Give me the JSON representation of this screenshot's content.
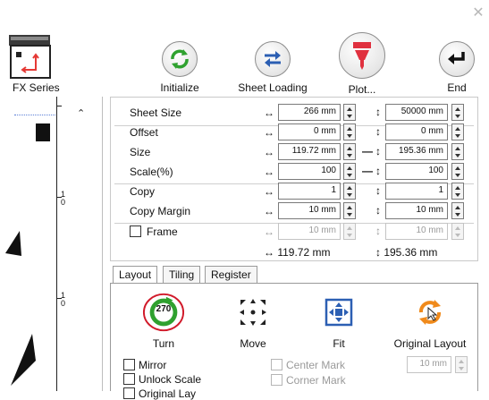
{
  "window": {
    "close_icon": "close-icon"
  },
  "device": {
    "label": "FX Series",
    "icon": "plotter-icon"
  },
  "toolbar": {
    "initialize": {
      "label": "Initialize",
      "icon": "refresh-icon"
    },
    "sheet_loading": {
      "label": "Sheet Loading",
      "icon": "swap-arrows-icon"
    },
    "plot": {
      "label": "Plot...",
      "icon": "cutter-pen-icon"
    },
    "end": {
      "label": "End",
      "icon": "return-arrow-icon"
    }
  },
  "settings": {
    "rows": [
      {
        "label": "Sheet Size",
        "w": "266 mm",
        "h": "50000 mm",
        "link": ""
      },
      {
        "label": "Offset",
        "w": "0 mm",
        "h": "0 mm",
        "link": ""
      },
      {
        "label": "Size",
        "w": "119.72 mm",
        "h": "195.36 mm",
        "link": "—"
      },
      {
        "label": "Scale(%)",
        "w": "100",
        "h": "100",
        "link": "—"
      },
      {
        "label": "Copy",
        "w": "1",
        "h": "1",
        "link": ""
      },
      {
        "label": "Copy Margin",
        "w": "10 mm",
        "h": "10 mm",
        "link": ""
      },
      {
        "label": "Frame",
        "w": "10 mm",
        "h": "10 mm",
        "link": ""
      }
    ],
    "arrow_horizontal": "↔",
    "arrow_vertical": "↕",
    "total_w": "↔ 119.72 mm",
    "total_h": "↕ 195.36 mm"
  },
  "tabs": [
    "Layout",
    "Tiling",
    "Register Mark"
  ],
  "layout_tools": {
    "turn": {
      "label": "Turn",
      "value": "270"
    },
    "move": {
      "label": "Move"
    },
    "fit": {
      "label": "Fit"
    },
    "original_layout": {
      "label": "Original Layout"
    }
  },
  "options": {
    "mirror": "Mirror",
    "unlock_scale": "Unlock Scale",
    "original_layout_cb": "Original Lay",
    "center_mark": "Center Mark",
    "corner_mark": "Corner Mark",
    "mark_margin": "10 mm"
  },
  "colors": {
    "green": "#2fa12f",
    "red": "#d11a2a",
    "blue": "#2c5fb3",
    "orange": "#f08a1b"
  }
}
